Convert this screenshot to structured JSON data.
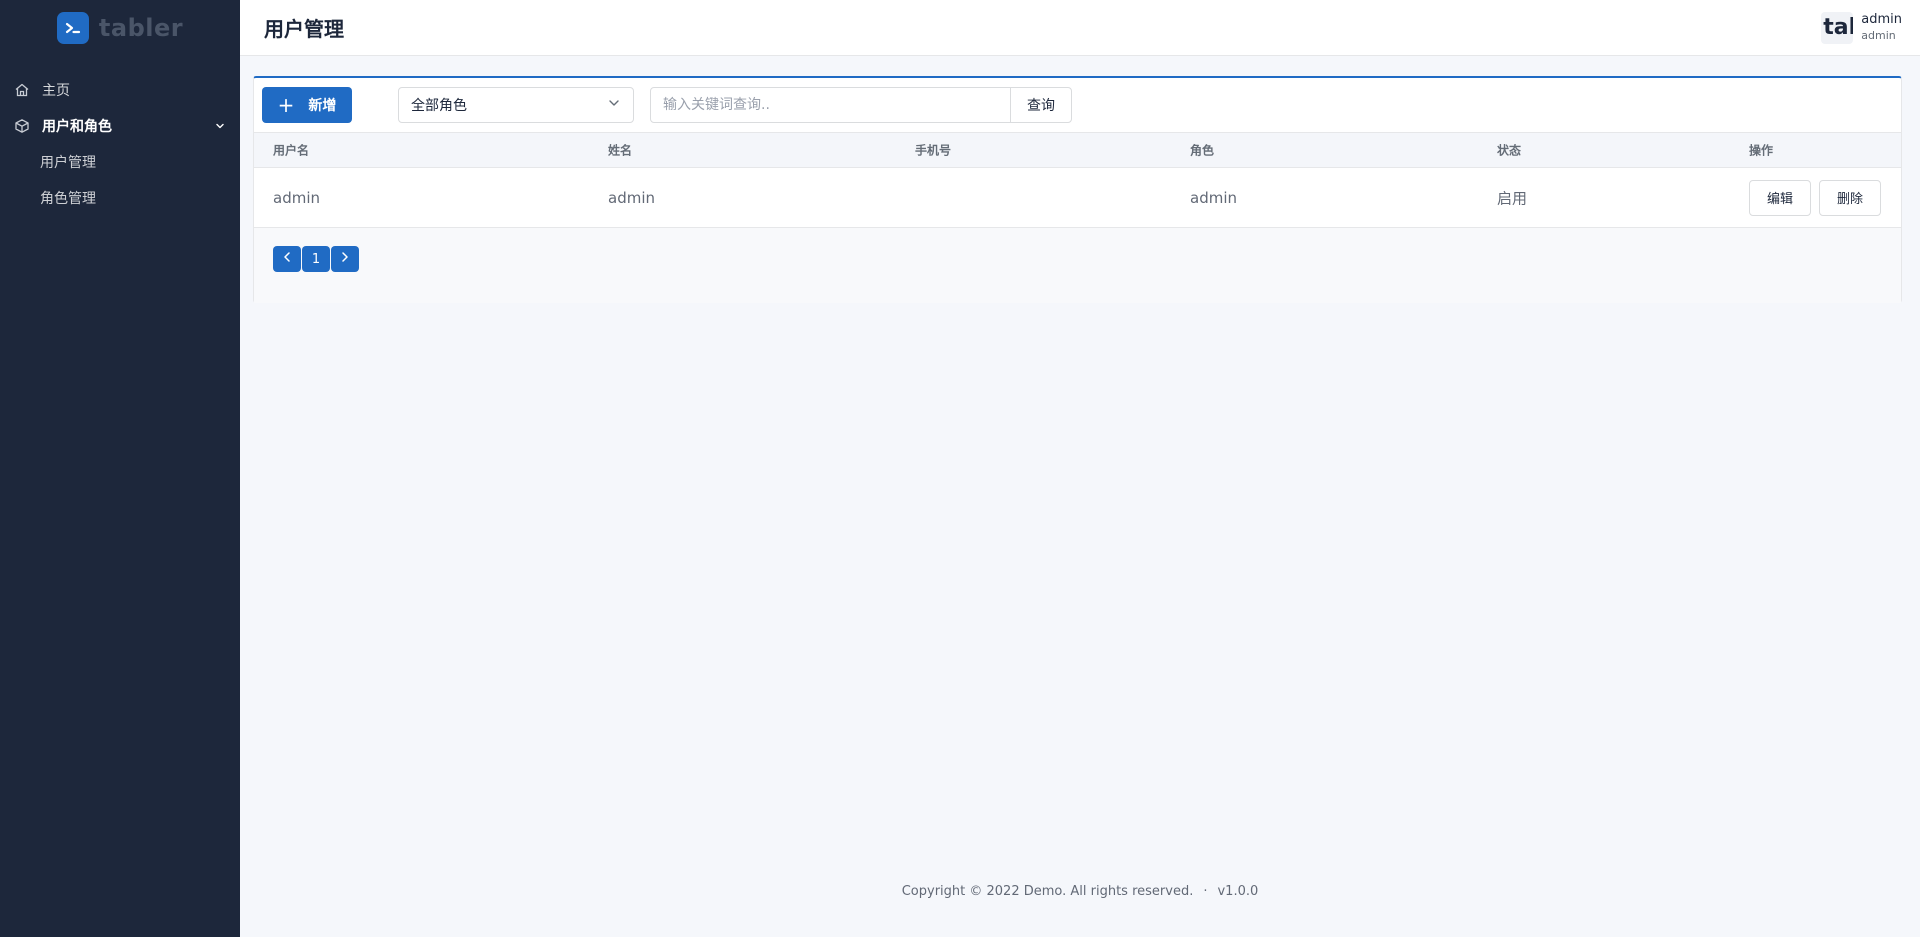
{
  "brand": {
    "name": "tabler"
  },
  "sidebar": {
    "items": [
      {
        "label": "主页",
        "icon": "home-icon"
      },
      {
        "label": "用户和角色",
        "icon": "box-icon"
      }
    ],
    "sub_items": [
      {
        "label": "用户管理"
      },
      {
        "label": "角色管理"
      }
    ]
  },
  "header": {
    "title": "用户管理",
    "avatar_text": "tabler",
    "user_name": "admin",
    "user_role": "admin"
  },
  "toolbar": {
    "add_label": "新增",
    "role_select_value": "全部角色",
    "search_placeholder": "输入关键词查询..",
    "query_label": "查询"
  },
  "table": {
    "columns": [
      "用户名",
      "姓名",
      "手机号",
      "角色",
      "状态",
      "操作"
    ],
    "rows": [
      {
        "username": "admin",
        "name": "admin",
        "phone": "",
        "role": "admin",
        "status": "启用",
        "edit_label": "编辑",
        "delete_label": "删除"
      }
    ]
  },
  "pagination": {
    "current": "1"
  },
  "footer": {
    "copyright": "Copyright © 2022 Demo. All rights reserved.",
    "dot": "·",
    "version": "v1.0.0"
  },
  "colors": {
    "sidebar_bg": "#1d273b",
    "primary": "#206bc4",
    "page_bg": "#f5f7fb"
  }
}
